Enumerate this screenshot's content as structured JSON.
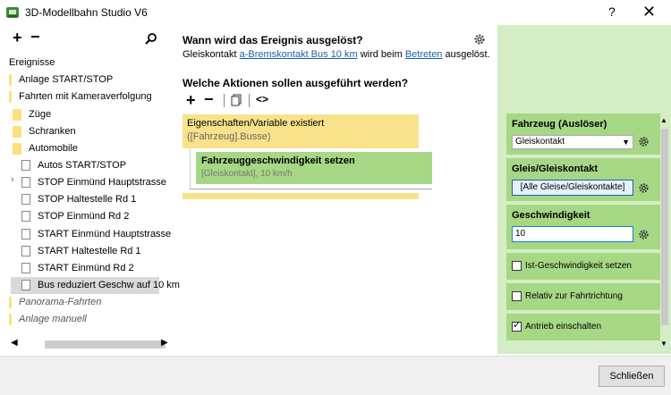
{
  "window": {
    "title": "3D-Modellbahn Studio V6",
    "help": "?",
    "close": "✕"
  },
  "toolbar": {
    "add": "+",
    "remove": "−"
  },
  "tree": {
    "items": [
      {
        "label": "Ereignisse"
      },
      {
        "label": "Anlage START/STOP"
      },
      {
        "label": "Fahrten mit Kameraverfolgung"
      },
      {
        "label": "Züge"
      },
      {
        "label": "Schranken"
      },
      {
        "label": "Automobile"
      },
      {
        "label": "Autos START/STOP"
      },
      {
        "label": "STOP Einmünd Hauptstrasse"
      },
      {
        "label": "STOP Haltestelle Rd 1"
      },
      {
        "label": "STOP Einmünd Rd 2"
      },
      {
        "label": "START Einmünd Hauptstrasse"
      },
      {
        "label": "START Haltestelle Rd 1"
      },
      {
        "label": "START Einmünd Rd 2"
      },
      {
        "label": "Bus reduziert Geschw auf 10 km"
      },
      {
        "label": "Panorama-Fahrten"
      },
      {
        "label": "Anlage manuell"
      }
    ]
  },
  "event": {
    "when_heading": "Wann wird das Ereignis ausgelöst?",
    "trigger_prefix": "Gleiskontakt ",
    "trigger_link": "a-Bremskontakt Bus 10 km",
    "trigger_mid": " wird beim ",
    "trigger_link2": "Betreten",
    "trigger_suffix": " ausgelöst.",
    "actions_heading": "Welche Aktionen sollen ausgeführt werden?",
    "code_label": "<>",
    "condition": {
      "title": "Eigenschaften/Variable existiert",
      "sub": "([Fahrzeug].Busse)"
    },
    "action": {
      "title": "Fahrzeuggeschwindigkeit setzen",
      "sub": "[Gleiskontakt], 10 km/h"
    }
  },
  "props": {
    "vehicle_label": "Fahrzeug (Auslöser)",
    "vehicle_value": "Gleiskontakt",
    "track_label": "Gleis/Gleiskontakt",
    "track_value": "[Alle Gleise/Gleiskontakte]",
    "speed_label": "Geschwindigkeit",
    "speed_value": "10",
    "cb1": "Ist-Geschwindigkeit setzen",
    "cb2": "Relativ zur Fahrtrichtung",
    "cb3": "Antrieb einschalten"
  },
  "footer": {
    "close_label": "Schließen"
  }
}
